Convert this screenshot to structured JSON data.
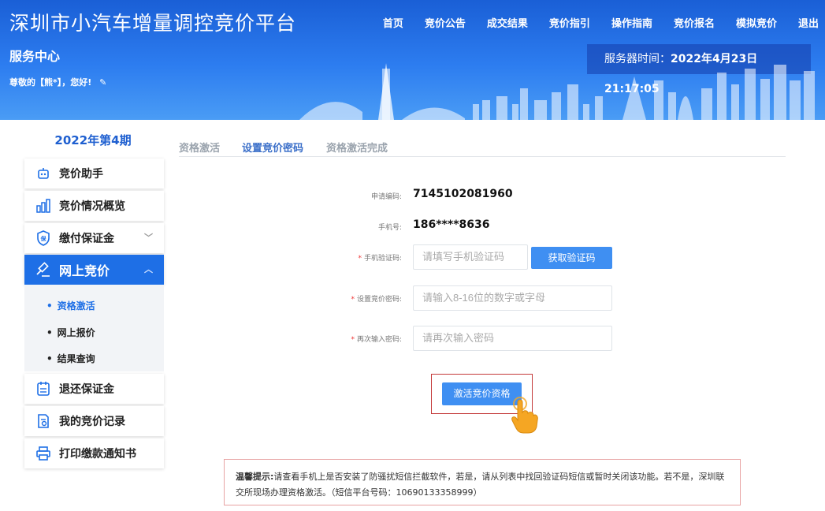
{
  "header": {
    "site_title": "深圳市小汽车增量调控竞价平台",
    "service_center": "服务中心",
    "greeting": "尊敬的【熊*】，您好!",
    "server_time_label": "服务器时间：",
    "server_time_value": "2022年4月23日 21:17:05",
    "nav": [
      "首页",
      "竞价公告",
      "成交结果",
      "竞价指引",
      "操作指南",
      "竞价报名",
      "模拟竞价",
      "退出"
    ]
  },
  "sidebar": {
    "period": "2022年第4期",
    "items": [
      {
        "label": "竞价助手",
        "icon": "robot-icon"
      },
      {
        "label": "竞价情况概览",
        "icon": "bar-chart-icon"
      },
      {
        "label": "缴付保证金",
        "icon": "shield-deposit-icon"
      },
      {
        "label": "网上竞价",
        "icon": "gavel-icon"
      },
      {
        "label": "退还保证金",
        "icon": "calendar-refund-icon"
      },
      {
        "label": "我的竞价记录",
        "icon": "record-search-icon"
      },
      {
        "label": "打印缴款通知书",
        "icon": "printer-icon"
      }
    ],
    "submenu": [
      "资格激活",
      "网上报价",
      "结果查询"
    ]
  },
  "tabs": [
    "资格激活",
    "设置竞价密码",
    "资格激活完成"
  ],
  "form": {
    "app_code_label": "申请编码:",
    "app_code_value": "7145102081960",
    "phone_label": "手机号:",
    "phone_value": "186****8636",
    "sms_label": "手机验证码:",
    "sms_placeholder": "请填写手机验证码",
    "get_code_button": "获取验证码",
    "pwd_label": "设置竞价密码:",
    "pwd_placeholder": "请输入8-16位的数字或字母",
    "pwd2_label": "再次输入密码:",
    "pwd2_placeholder": "请再次输入密码",
    "activate_button": "激活竞价资格"
  },
  "notice": {
    "title": "温馨提示:",
    "body": "请查看手机上是否安装了防骚扰短信拦截软件，若是，请从列表中找回验证码短信或暂时关闭该功能。若不是，深圳联交所现场办理资格激活。（短信平台号码：10690133358999）"
  },
  "colors": {
    "brand_blue": "#1e6fe6",
    "button_blue": "#3f8ff2",
    "required_red": "#e33333"
  }
}
